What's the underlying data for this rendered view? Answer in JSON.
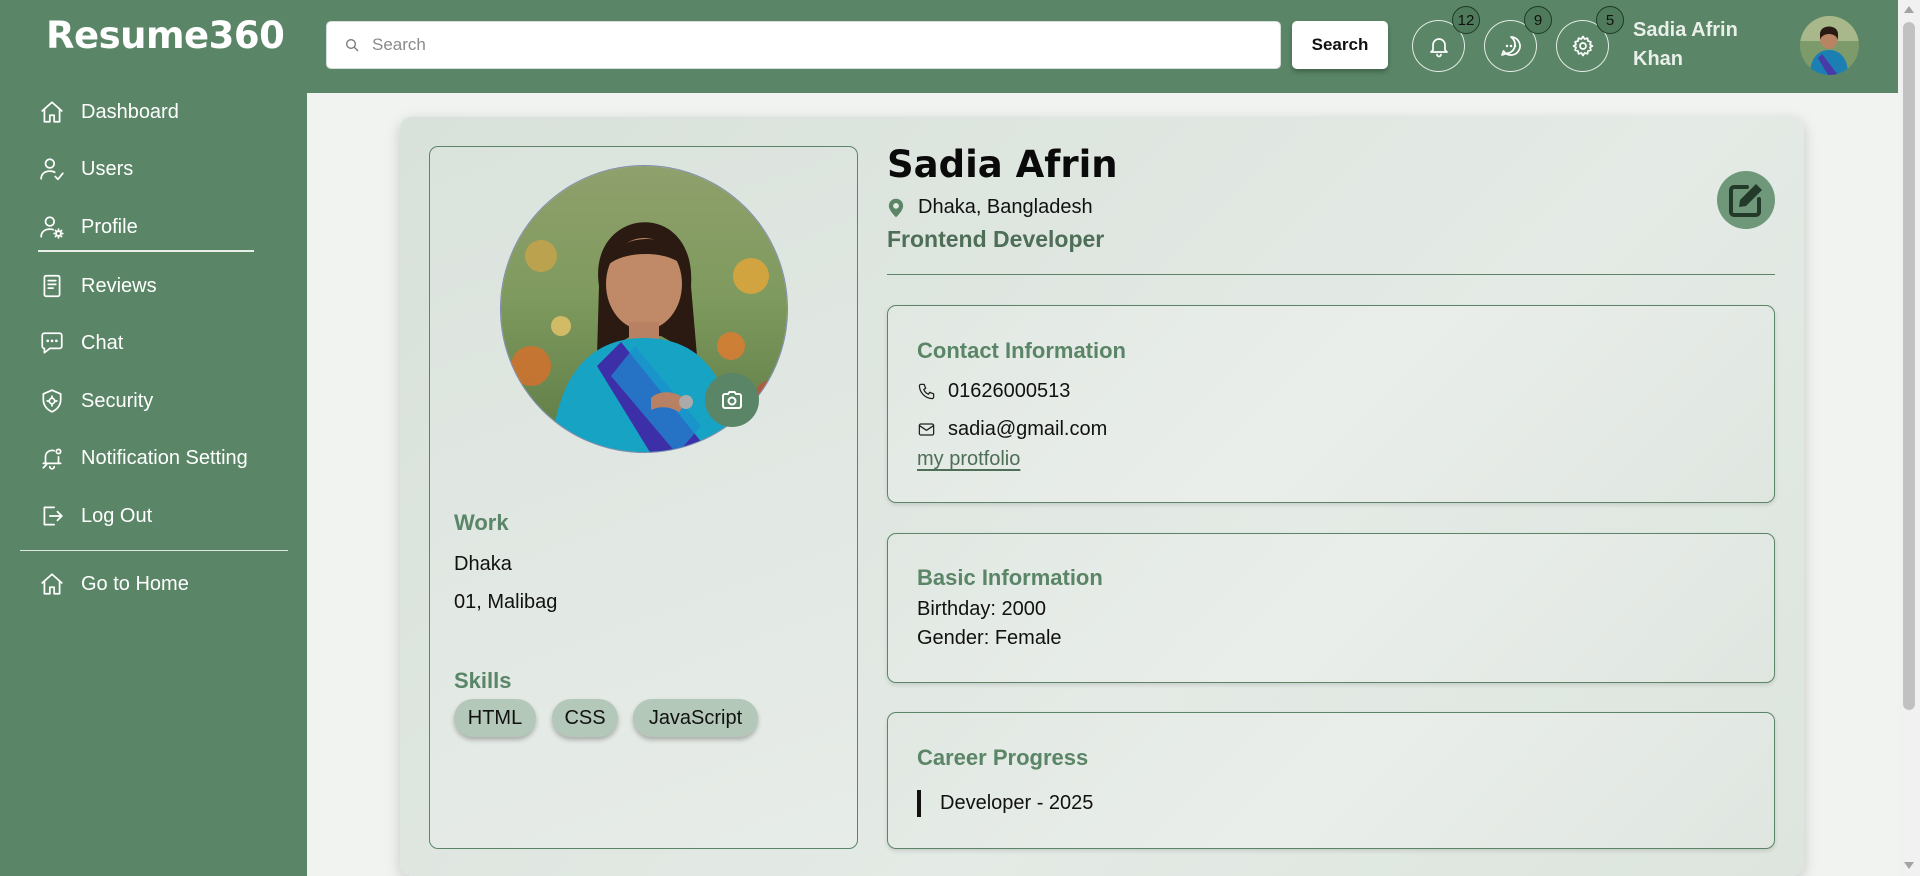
{
  "app": {
    "logo": "Resume360"
  },
  "sidebar": {
    "items": [
      {
        "label": "Dashboard",
        "icon": "home-icon"
      },
      {
        "label": "Users",
        "icon": "user-check-icon"
      },
      {
        "label": "Profile",
        "icon": "user-gear-icon"
      },
      {
        "label": "Reviews",
        "icon": "document-icon"
      },
      {
        "label": "Chat",
        "icon": "chat-icon"
      },
      {
        "label": "Security",
        "icon": "shield-gear-icon"
      },
      {
        "label": "Notification Setting",
        "icon": "bell-settings-icon"
      },
      {
        "label": "Log Out",
        "icon": "logout-icon"
      },
      {
        "label": "Go to Home",
        "icon": "home-icon"
      }
    ],
    "active": "Profile"
  },
  "header": {
    "search_placeholder": "Search",
    "search_value": "",
    "search_button": "Search",
    "notifications_count": "12",
    "messages_count": "9",
    "settings_count": "5",
    "user_name": "Sadia Afrin Khan"
  },
  "profile": {
    "name": "Sadia Afrin",
    "location": "Dhaka, Bangladesh",
    "role": "Frontend Developer",
    "work_label": "Work",
    "work_city": "Dhaka",
    "work_address": "01, Malibag",
    "skills_label": "Skills",
    "skills": [
      "HTML",
      "CSS",
      "JavaScript"
    ]
  },
  "contact": {
    "title": "Contact Information",
    "phone": "01626000513",
    "email": "sadia@gmail.com",
    "portfolio_link": "my protfolio"
  },
  "basic": {
    "title": "Basic Information",
    "birthday": "Birthday: 2000",
    "gender": "Gender: Female"
  },
  "career": {
    "title": "Career Progress",
    "entries": [
      "Developer - 2025"
    ]
  },
  "colors": {
    "brand_green": "#5a8566",
    "role_green": "#4e6e57",
    "chip_bg": "#b4c8b9"
  }
}
